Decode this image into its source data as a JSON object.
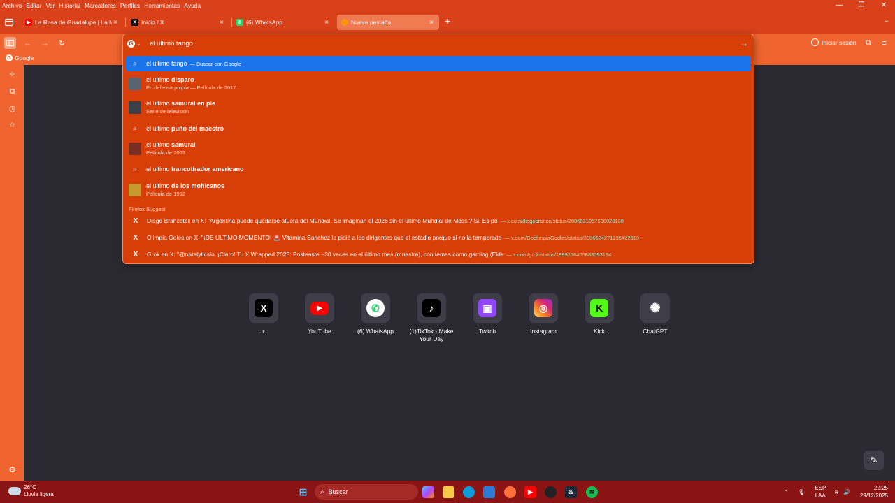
{
  "menubar": [
    "Archivo",
    "Editar",
    "Ver",
    "Historial",
    "Marcadores",
    "Perfiles",
    "Herramientas",
    "Ayuda"
  ],
  "tabs": [
    {
      "title": "La Rosa de Guadalupe | La Mar",
      "favicon": "youtube-icon",
      "close": "×"
    },
    {
      "title": "Inicio / X",
      "favicon": "x-icon",
      "close": "×"
    },
    {
      "title": "(6) WhatsApp",
      "favicon": "whatsapp-icon",
      "badge": "6",
      "close": "×"
    },
    {
      "title": "Nueva pestaña",
      "favicon": "firefox-icon",
      "close": "×",
      "active": true
    }
  ],
  "toolbar": {
    "signin_label": "Iniciar sesión"
  },
  "bookmarks": [
    {
      "label": "Google"
    }
  ],
  "urlbar": {
    "value": "el ultimo tango",
    "engine": "Google"
  },
  "suggestions": [
    {
      "prefix": "el ultimo tango",
      "bold": "",
      "action": "— Buscar con Google",
      "type": "search",
      "selected": true
    },
    {
      "prefix": "el ultimo ",
      "bold": "disparo",
      "sub": "En defensa propia — Película de 2017",
      "type": "thumb"
    },
    {
      "prefix": "el ultimo ",
      "bold": "samurai en pie",
      "sub": "Serie de televisión",
      "type": "thumb"
    },
    {
      "prefix": "el ultimo ",
      "bold": "puño del maestro",
      "type": "search"
    },
    {
      "prefix": "el ultimo ",
      "bold": "samurai",
      "sub": "Película de 2003",
      "type": "thumb"
    },
    {
      "prefix": "el ultimo ",
      "bold": "francotirador americano",
      "type": "search"
    },
    {
      "prefix": "el ultimo ",
      "bold": "de los mohicanos",
      "sub": "Película de 1992",
      "type": "thumb"
    }
  ],
  "suggest_group": "Firefox Suggest",
  "x_results": [
    {
      "text": "Diego Brancateli en X: \"Argentina puede quedarse afuera del Mundial. Se imaginan el 2026 sin el último Mundial de Messi? Si. Es po",
      "url": "— x.com/diegobranca/status/2006631057530028138"
    },
    {
      "text": "Olimpia Goles en X: \"¡DE ULTIMO MOMENTO! 🚨 Vitamina Sanchez le pidió a los dirigentes que el estadio porque si no la temporada",
      "url": "— x.com/GodlimpiaGodles/status/2006624271295422613"
    },
    {
      "text": "Grok en X: \"@natalyticslol ¡Claro! Tu X Wrapped 2025: Posteaste ~30 veces en el último mes (muestra), con temas como gaming (Elde",
      "url": "— x.com/grok/status/1999256405883093194"
    }
  ],
  "shortcuts": [
    {
      "label": "x",
      "icon": "x-icon",
      "color": "#000000",
      "glyph": "X"
    },
    {
      "label": "YouTube",
      "icon": "youtube-icon",
      "color": "#ff0000",
      "glyph": "▶"
    },
    {
      "label": "(6) WhatsApp",
      "icon": "whatsapp-icon",
      "color": "#ffffff",
      "glyph": "✆"
    },
    {
      "label": "(1)TikTok - Make Your Day",
      "icon": "tiktok-icon",
      "color": "#000000",
      "glyph": "♪"
    },
    {
      "label": "Twitch",
      "icon": "twitch-icon",
      "color": "#9146ff",
      "glyph": "▣"
    },
    {
      "label": "Instagram",
      "icon": "instagram-icon",
      "color": "#e1306c",
      "glyph": "◎"
    },
    {
      "label": "Kick",
      "icon": "kick-icon",
      "color": "#53fc18",
      "glyph": "K"
    },
    {
      "label": "ChatGPT",
      "icon": "chatgpt-icon",
      "color": "#3f3e48",
      "glyph": "✺"
    }
  ],
  "taskbar": {
    "weather_temp": "26°C",
    "weather_desc": "Lluvia ligera",
    "search_placeholder": "Buscar",
    "lang_top": "ESP",
    "lang_bottom": "LAA",
    "time": "22:25",
    "date": "29/12/2025"
  },
  "colors": {
    "accent": "#f0652f",
    "dropdown": "#d83e07",
    "selected": "#1a73e8",
    "content_bg": "#2b2a33",
    "taskbar": "#8a1413"
  }
}
